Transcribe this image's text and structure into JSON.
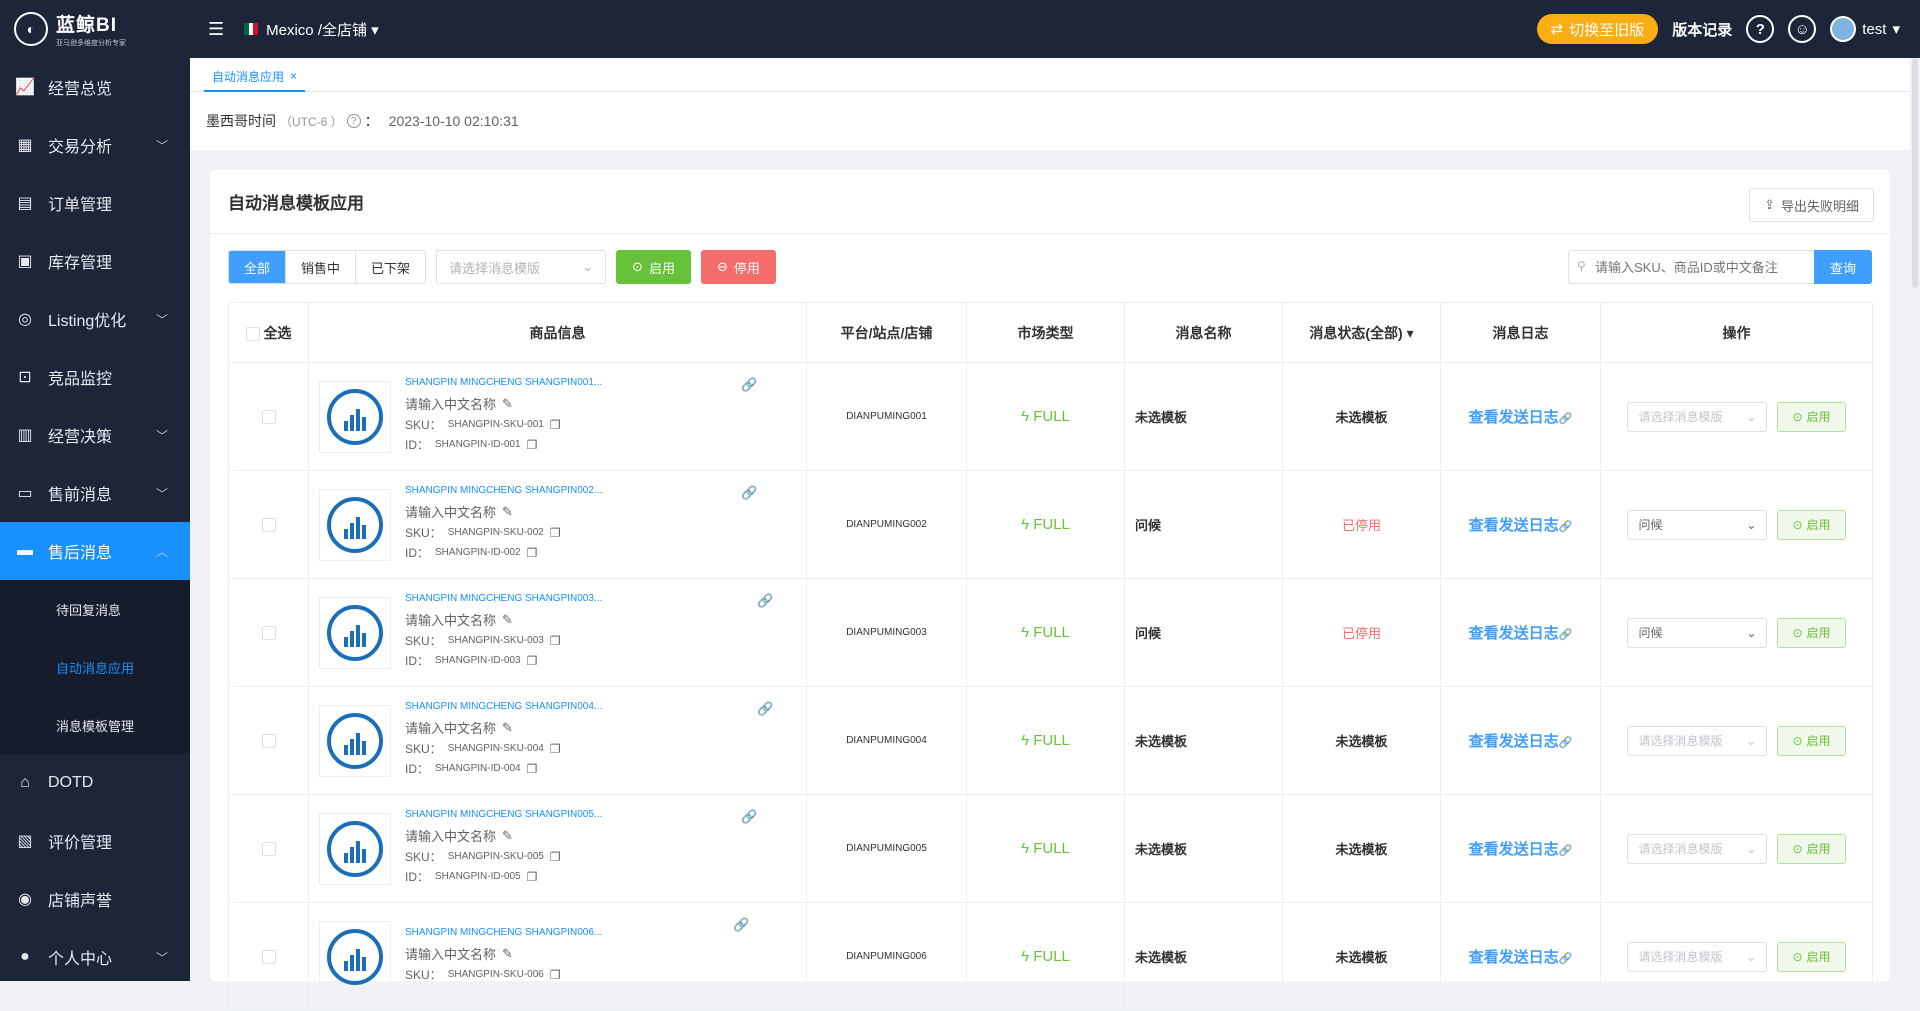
{
  "brand": {
    "name": "蓝鲸BI",
    "tagline": "亚马逊多维度分析专家"
  },
  "sidebar": {
    "items": [
      {
        "label": "经营总览",
        "icon": "chart-line-icon",
        "chevron": false
      },
      {
        "label": "交易分析",
        "icon": "trade-chart-icon",
        "chevron": true
      },
      {
        "label": "订单管理",
        "icon": "order-doc-icon",
        "chevron": false
      },
      {
        "label": "库存管理",
        "icon": "inventory-icon",
        "chevron": false
      },
      {
        "label": "Listing优化",
        "icon": "target-icon",
        "chevron": true
      },
      {
        "label": "竞品监控",
        "icon": "monitor-lock-icon",
        "chevron": false
      },
      {
        "label": "经营决策",
        "icon": "decision-board-icon",
        "chevron": true
      },
      {
        "label": "售前消息",
        "icon": "message-icon",
        "chevron": true
      },
      {
        "label": "售后消息",
        "icon": "chat-icon",
        "chevron": true,
        "active": true
      }
    ],
    "submenu": [
      {
        "label": "待回复消息"
      },
      {
        "label": "自动消息应用",
        "active": true
      },
      {
        "label": "消息模板管理"
      }
    ],
    "items_after": [
      {
        "label": "DOTD",
        "icon": "lock-icon",
        "chevron": false
      },
      {
        "label": "评价管理",
        "icon": "review-icon",
        "chevron": false
      },
      {
        "label": "店铺声誉",
        "icon": "reputation-icon",
        "chevron": false
      },
      {
        "label": "个人中心",
        "icon": "user-icon",
        "chevron": true
      }
    ]
  },
  "topbar": {
    "store": "Mexico /全店铺",
    "old_version": "切换至旧版",
    "version_log": "版本记录",
    "help": "?",
    "user": "test"
  },
  "tabs": [
    {
      "label": "自动消息应用",
      "close": "×"
    }
  ],
  "timebar": {
    "label": "墨西哥时间",
    "tz": "（UTC-6 ）",
    "colon": "：",
    "datetime": "2023-10-10 02:10:31"
  },
  "card": {
    "title": "自动消息模板应用",
    "export": "导出失败明细"
  },
  "filters": {
    "segments": [
      "全部",
      "销售中",
      "已下架"
    ],
    "template_placeholder": "请选择消息模版",
    "enable": "启用",
    "disable": "停用",
    "search_placeholder": "请输入SKU、商品ID或中文备注",
    "query": "查询"
  },
  "table": {
    "headers": {
      "select_all": "全选",
      "product": "商品信息",
      "store": "平台/站点/店铺",
      "market": "市场类型",
      "msg_name": "消息名称",
      "msg_status": "消息状态(全部)",
      "msg_log": "消息日志",
      "ops": "操作"
    },
    "rows": [
      {
        "name": "SHANGPIN MINGCHENG SHANGPIN001...",
        "cn_placeholder": "请输入中文名称",
        "sku_label": "SKU：",
        "sku": "SHANGPIN-SKU-001",
        "id_label": "ID：",
        "id": "SHANGPIN-ID-001",
        "store": "DIANPUMING001",
        "market": "FULL",
        "template": "未选模板",
        "status": "未选模板",
        "stopped": false,
        "log": "查看发送日志",
        "op_select": "请选择消息模版",
        "op_placeholder": true,
        "op_btn": "启用"
      },
      {
        "name": "SHANGPIN MINGCHENG SHANGPIN002...",
        "cn_placeholder": "请输入中文名称",
        "sku_label": "SKU：",
        "sku": "SHANGPIN-SKU-002",
        "id_label": "ID：",
        "id": "SHANGPIN-ID-002",
        "store": "DIANPUMING002",
        "market": "FULL",
        "template": "问候",
        "status": "已停用",
        "stopped": true,
        "log": "查看发送日志",
        "op_select": "问候",
        "op_placeholder": false,
        "op_btn": "启用"
      },
      {
        "name": "SHANGPIN MINGCHENG SHANGPIN003...",
        "cn_placeholder": "请输入中文名称",
        "sku_label": "SKU：",
        "sku": "SHANGPIN-SKU-003",
        "id_label": "ID：",
        "id": "SHANGPIN-ID-003",
        "store": "DIANPUMING003",
        "market": "FULL",
        "template": "问候",
        "status": "已停用",
        "stopped": true,
        "log": "查看发送日志",
        "op_select": "问候",
        "op_placeholder": false,
        "op_btn": "启用"
      },
      {
        "name": "SHANGPIN MINGCHENG SHANGPIN004...",
        "cn_placeholder": "请输入中文名称",
        "sku_label": "SKU：",
        "sku": "SHANGPIN-SKU-004",
        "id_label": "ID：",
        "id": "SHANGPIN-ID-004",
        "store": "DIANPUMING004",
        "market": "FULL",
        "template": "未选模板",
        "status": "未选模板",
        "stopped": false,
        "log": "查看发送日志",
        "op_select": "请选择消息模版",
        "op_placeholder": true,
        "op_btn": "启用"
      },
      {
        "name": "SHANGPIN MINGCHENG SHANGPIN005...",
        "cn_placeholder": "请输入中文名称",
        "sku_label": "SKU：",
        "sku": "SHANGPIN-SKU-005",
        "id_label": "ID：",
        "id": "SHANGPIN-ID-005",
        "store": "DIANPUMING005",
        "market": "FULL",
        "template": "未选模板",
        "status": "未选模板",
        "stopped": false,
        "log": "查看发送日志",
        "op_select": "请选择消息模版",
        "op_placeholder": true,
        "op_btn": "启用"
      },
      {
        "name": "SHANGPIN MINGCHENG SHANGPIN006...",
        "cn_placeholder": "请输入中文名称",
        "sku_label": "SKU：",
        "sku": "SHANGPIN-SKU-006",
        "id_label": "ID：",
        "id": "",
        "store": "DIANPUMING006",
        "market": "FULL",
        "template": "未选模板",
        "status": "未选模板",
        "stopped": false,
        "log": "查看发送日志",
        "op_select": "请选择消息模版",
        "op_placeholder": true,
        "op_btn": "启用"
      }
    ]
  },
  "colors": {
    "sidebar_bg": "#1d2538",
    "accent": "#1890ff",
    "success": "#67c23a",
    "danger": "#f56c6c",
    "warning": "#faad14"
  }
}
